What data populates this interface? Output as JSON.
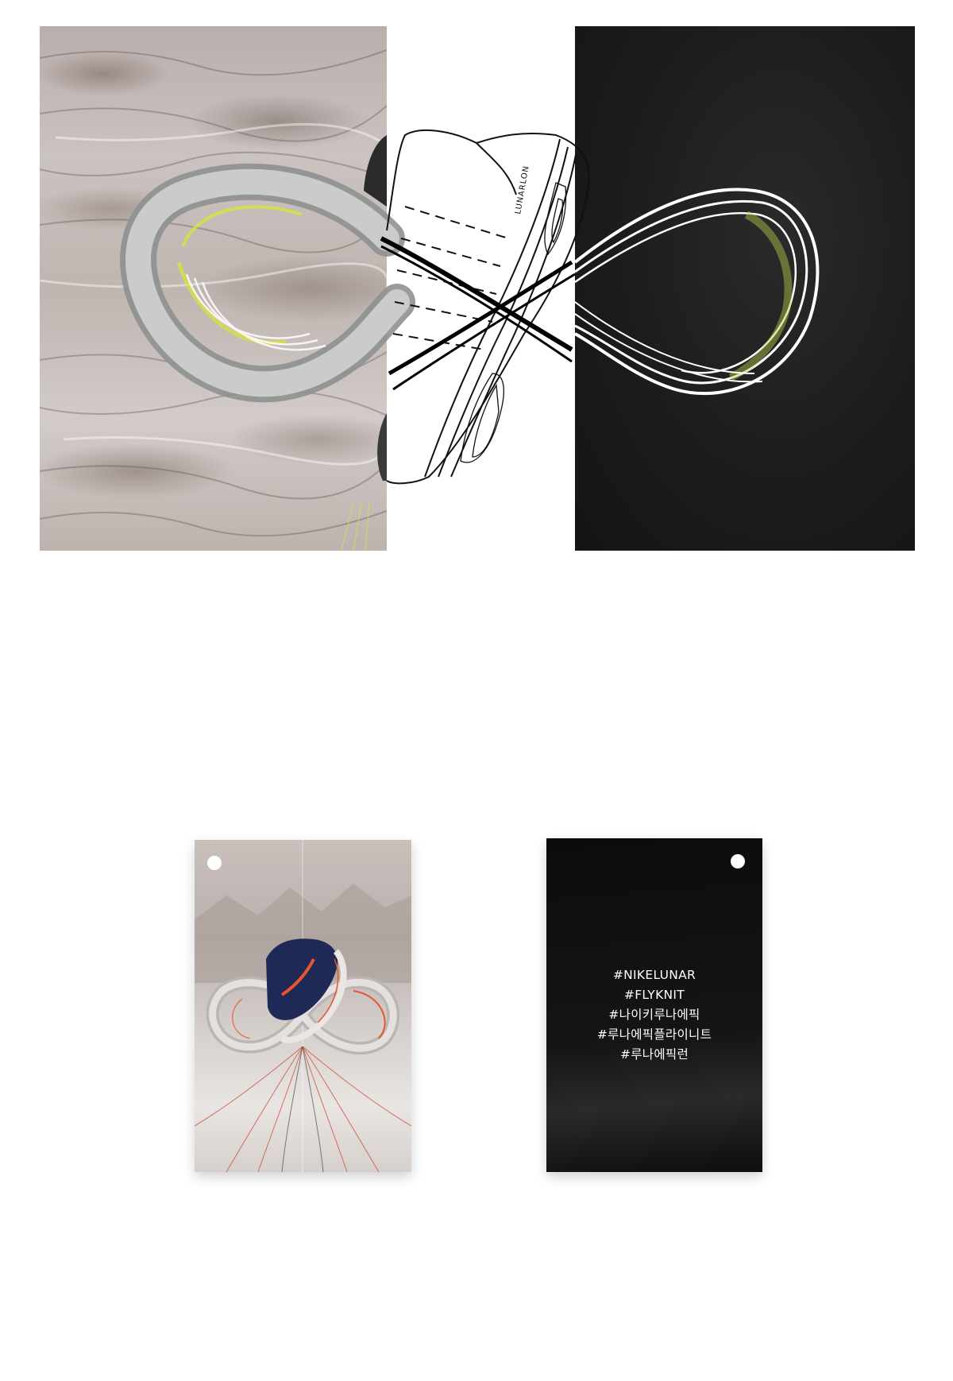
{
  "visual_top": {
    "left_panel": "desert-landscape-photo",
    "center_illustration": "shoe-line-drawing-with-infinity-ribbon",
    "right_panel": "black-background-with-infinity-ribbon",
    "shoe_brand_text": "LUNARLON"
  },
  "hang_tag_front": {
    "image": "desert-infinity-shoe-photo"
  },
  "hang_tag_back": {
    "hashtags": [
      "#NIKELUNAR",
      "#FLYKNIT",
      "#나이키루나에픽",
      "#루나에픽플라이니트",
      "#루나에픽런"
    ]
  },
  "colors": {
    "dark_panel": "#1b1b1b",
    "accent_green": "#c8e04a",
    "accent_orange": "#e8552e",
    "shoe_navy": "#1e2a55",
    "background": "#ffffff"
  }
}
